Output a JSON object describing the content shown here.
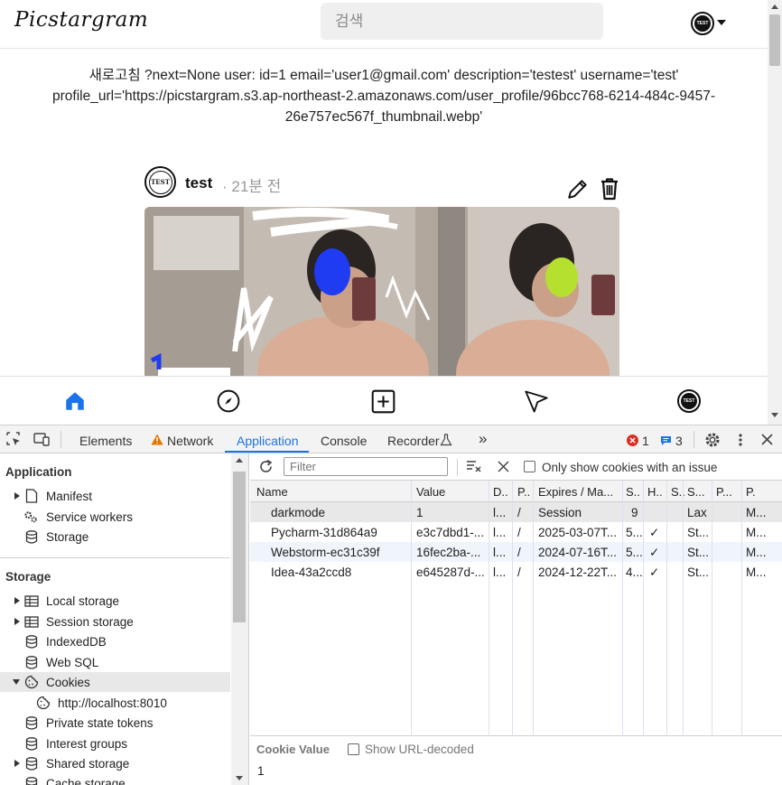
{
  "page": {
    "logo": "Picstargram",
    "search_placeholder": "검색",
    "debug_text": "새로고침 ?next=None user: id=1 email='user1@gmail.com' description='testest' username='test' profile_url='https://picstargram.s3.ap-northeast-2.amazonaws.com/user_profile/96bcc768-6214-484c-9457-26e757ec567f_thumbnail.webp'",
    "avatar_text": "TEST"
  },
  "post": {
    "username": "test",
    "time": "· 21분 전"
  },
  "icons": {
    "edit": "pencil-icon",
    "delete": "trash-icon",
    "home": "home-icon",
    "explore": "compass-icon",
    "create": "plus-square-icon",
    "direct": "paper-plane-icon",
    "profile": "avatar-icon"
  },
  "devtools": {
    "tabs": [
      "Elements",
      "Network",
      "Application",
      "Console",
      "Recorder"
    ],
    "more": "»",
    "error_count": "1",
    "message_count": "3",
    "sidebar": {
      "application_title": "Application",
      "application_items": [
        "Manifest",
        "Service workers",
        "Storage"
      ],
      "storage_title": "Storage",
      "storage_items": [
        "Local storage",
        "Session storage",
        "IndexedDB",
        "Web SQL",
        "Cookies",
        "http://localhost:8010",
        "Private state tokens",
        "Interest groups",
        "Shared storage",
        "Cache storage"
      ]
    },
    "toolbar": {
      "filter_placeholder": "Filter",
      "only_issues_label": "Only show cookies with an issue"
    },
    "table": {
      "headers": [
        "Name",
        "Value",
        "D..",
        "P..",
        "Expires / Ma...",
        "S..",
        "H..",
        "S..",
        "S...",
        "P...",
        "P."
      ],
      "rows": [
        [
          "darkmode",
          "1",
          "l...",
          "/",
          "Session",
          "9",
          "",
          "",
          "Lax",
          "",
          "M..."
        ],
        [
          "Pycharm-31d864a9",
          "e3c7dbd1-...",
          "l...",
          "/",
          "2025-03-07T...",
          "5...",
          "✓",
          "",
          "St...",
          "",
          "M..."
        ],
        [
          "Webstorm-ec31c39f",
          "16fec2ba-...",
          "l...",
          "/",
          "2024-07-16T...",
          "5...",
          "✓",
          "",
          "St...",
          "",
          "M..."
        ],
        [
          "Idea-43a2ccd8",
          "e645287d-...",
          "l...",
          "/",
          "2024-12-22T...",
          "4...",
          "✓",
          "",
          "St...",
          "",
          "M..."
        ]
      ]
    },
    "cookie_value_label": "Cookie Value",
    "show_decoded_label": "Show URL-decoded",
    "cookie_value": "1"
  },
  "colors": {
    "accent_blue": "#1a73e8",
    "home_active": "#1a73e8",
    "error_red": "#d93025",
    "warning_orange": "#e37400"
  }
}
